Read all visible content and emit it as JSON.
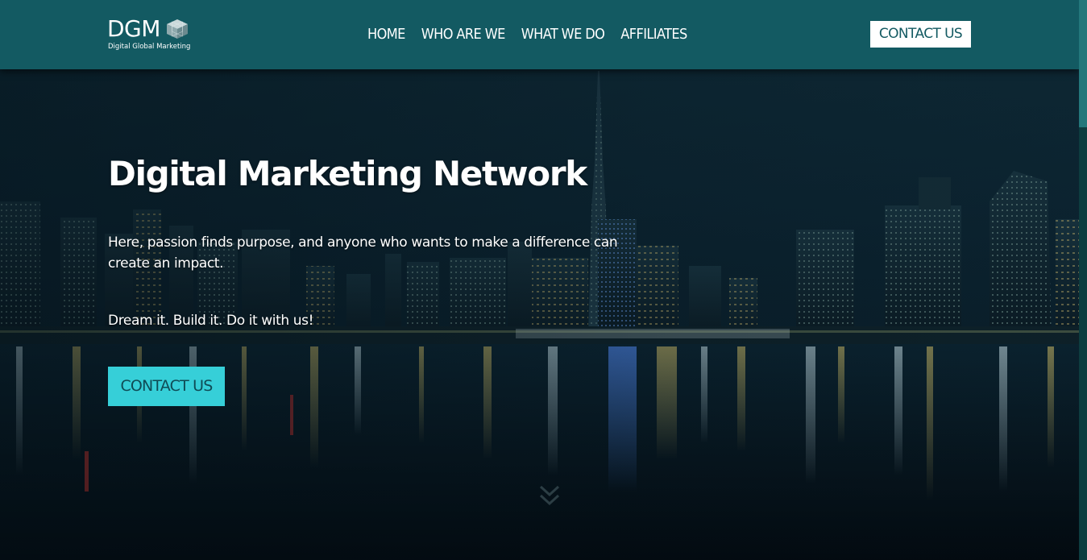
{
  "brand": {
    "logo_text": "DGM",
    "logo_subtitle": "Digital Global Marketing"
  },
  "nav": {
    "items": [
      {
        "label": "HOME"
      },
      {
        "label": "WHO ARE WE"
      },
      {
        "label": "WHAT WE DO"
      },
      {
        "label": "AFFILIATES"
      }
    ],
    "cta_label": "CONTACT US"
  },
  "hero": {
    "title": "Digital Marketing Network",
    "lead": "Here, passion finds purpose, and anyone who wants to make a difference can create an impact.",
    "tagline": "Dream it. Build it. Do it with us!",
    "cta_label": "CONTACT US",
    "scroll_icon": "chevron-down-icon"
  },
  "colors": {
    "header_bg": "#135a62",
    "accent": "#36cfd8",
    "hero_bg": "#0b2230"
  }
}
